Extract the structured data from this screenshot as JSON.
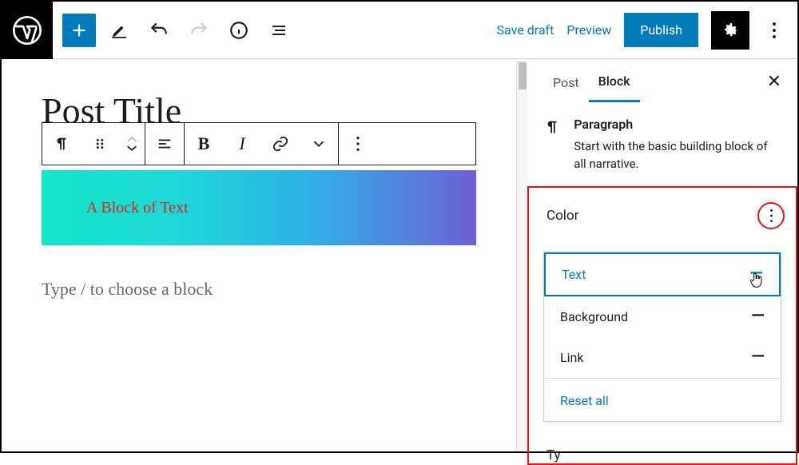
{
  "topbar": {
    "save_draft": "Save draft",
    "preview": "Preview",
    "publish": "Publish"
  },
  "editor": {
    "post_title": "Post Title",
    "block_text": "A Block of Text",
    "placeholder": "Type / to choose a block"
  },
  "sidebar": {
    "tabs": {
      "post": "Post",
      "block": "Block"
    },
    "block_info": {
      "title": "Paragraph",
      "desc": "Start with the basic building block of all narrative."
    },
    "color_panel": {
      "title": "Color",
      "items": {
        "text": "Text",
        "background": "Background",
        "link": "Link"
      },
      "reset": "Reset all"
    },
    "typography_stub": "Ty"
  }
}
